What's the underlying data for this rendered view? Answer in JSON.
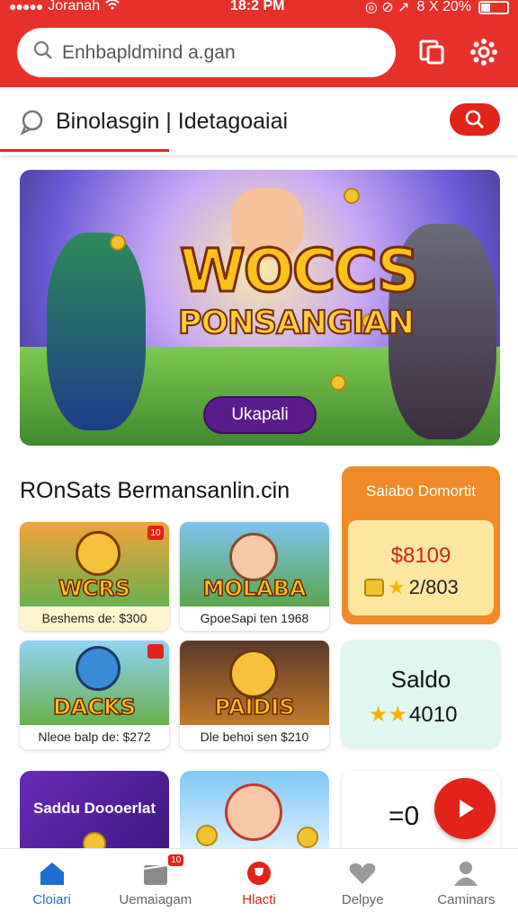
{
  "status_bar": {
    "carrier": "Joranah",
    "time": "18:2 PM",
    "battery": "8 X 20%"
  },
  "header": {
    "search_placeholder": "Enhbapldmind a.gan",
    "icons": [
      "copy-icon",
      "gear-icon"
    ],
    "colors": {
      "header_red": "#e8302a"
    }
  },
  "subheader": {
    "label": "Binolasgin | Idetagoaiai"
  },
  "banner": {
    "title": "WOCCS",
    "subtitle": "PONSANGIAN",
    "button": "Ukapali"
  },
  "section": {
    "title": "ROnSats Bermansanlin.cin"
  },
  "games": [
    {
      "title": "WCRS",
      "caption": "Beshems de: $300",
      "badge": "10"
    },
    {
      "title": "MOLABA",
      "caption": "GpoeSapi ten 1968"
    },
    {
      "title": "DACKS",
      "caption": "Nleoe balp de: $272",
      "badge": ""
    },
    {
      "title": "PAIDIS",
      "caption": "Dle behoi sen $210"
    }
  ],
  "balance_card": {
    "title": "Saiabo Domortit",
    "amount": "$8109",
    "points": "2/803"
  },
  "saldo_card": {
    "title": "Saldo",
    "value": "4010"
  },
  "promo": {
    "title": "Saddu Doooerlat",
    "formula": "=0"
  },
  "nav": [
    {
      "label": "Cloiari",
      "icon": "home-icon"
    },
    {
      "label": "Uemaiagam",
      "icon": "cards-icon",
      "badge": "10"
    },
    {
      "label": "Hlacti",
      "icon": "trophy-icon"
    },
    {
      "label": "Delpye",
      "icon": "heart-icon"
    },
    {
      "label": "Caminars",
      "icon": "person-icon"
    }
  ]
}
